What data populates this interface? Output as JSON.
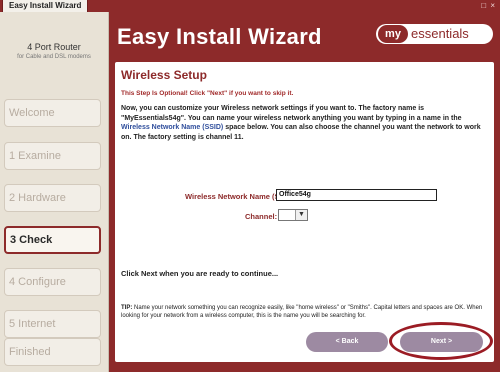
{
  "window": {
    "tab_title": "Easy Install Wizard",
    "controls": "□ ×"
  },
  "sidebar": {
    "product_title": "4 Port Router",
    "product_subtitle": "for Cable and DSL modems",
    "steps": [
      {
        "label": "Welcome"
      },
      {
        "label": "1 Examine"
      },
      {
        "label": "2 Hardware"
      },
      {
        "label": "3 Check"
      },
      {
        "label": "4 Configure"
      },
      {
        "label": "5 Internet"
      },
      {
        "label": "Finished"
      }
    ]
  },
  "header": {
    "title": "Easy Install Wizard",
    "logo_prefix": "my",
    "logo_suffix": "essentials"
  },
  "content": {
    "page_title": "Wireless Setup",
    "optional_note": "This Step Is Optional! Click \"Next\" if you want to skip it.",
    "desc_part1": "Now, you can customize your Wireless network settings if you want to. The factory name is \"MyEssentials54g\". You can name your wireless network anything you want by typing in a name in the ",
    "desc_ssid_link": "Wireless Network Name (SSID)",
    "desc_part2": " space below. You can also choose the channel you want the network to work on. The factory setting is channel 11.",
    "ssid_label": "Wireless Network Name (SSID):",
    "ssid_value": "Office54g",
    "channel_label": "Channel:",
    "channel_value": "",
    "continue_text": "Click Next when you are ready to continue...",
    "tip_label": "TIP:",
    "tip_text": " Name your network something you can recognize easily, like \"home wireless\" or \"Smiths\". Capital letters and spaces are OK. When looking for your network from a wireless computer, this is the name you will be searching for."
  },
  "buttons": {
    "back": "< Back",
    "next": "Next >"
  },
  "colors": {
    "brand": "#8d2a2a",
    "button": "#9d8aa2",
    "highlight_ring": "#9b1c24"
  }
}
